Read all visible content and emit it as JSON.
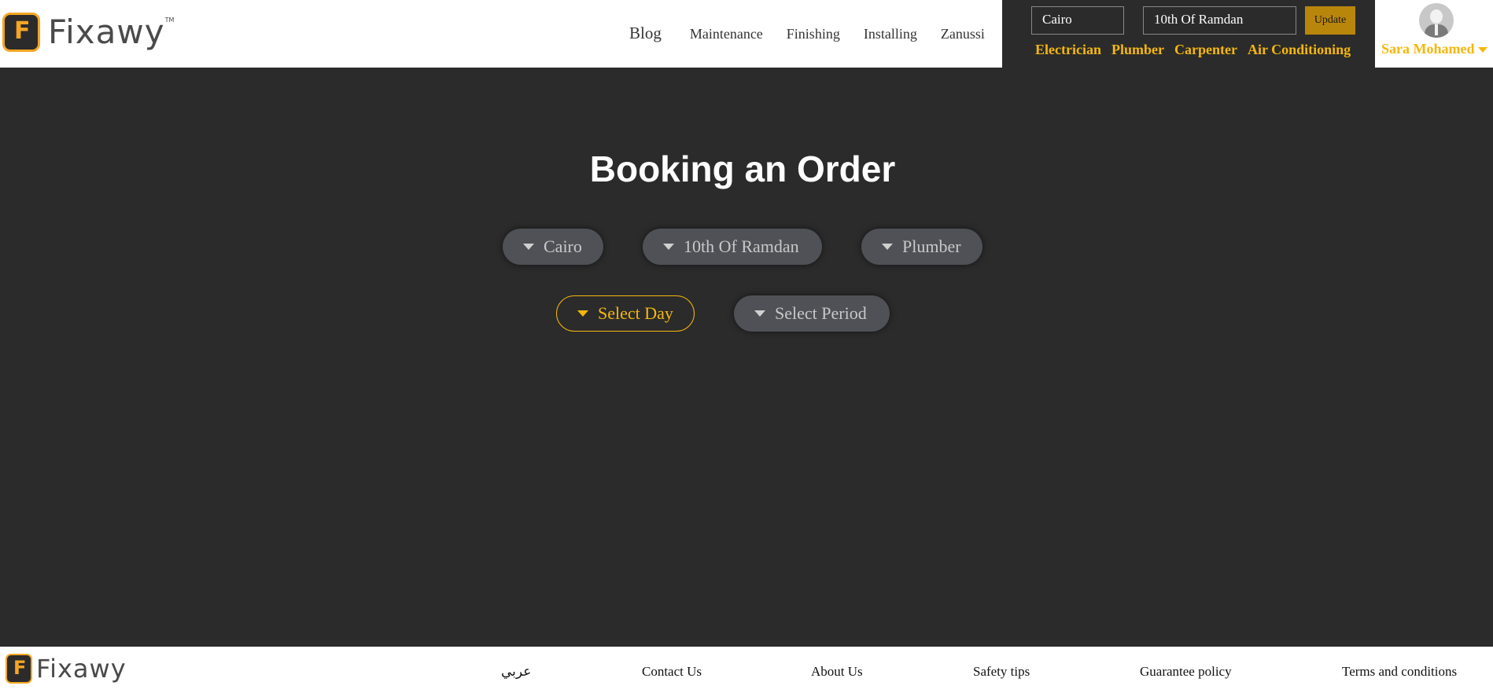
{
  "header": {
    "brand": "Fixawy",
    "brand_tm": "TM",
    "nav": [
      "Blog",
      "Maintenance",
      "Finishing",
      "Installing",
      "Zanussi"
    ],
    "city_select": "Cairo",
    "area_select": "10th Of Ramdan",
    "update_label": "Update",
    "categories": [
      "Electrician",
      "Plumber",
      "Carpenter",
      "Air Conditioning"
    ],
    "user_name": "Sara Mohamed"
  },
  "main": {
    "title": "Booking an Order",
    "city": "Cairo",
    "area": "10th Of Ramdan",
    "service": "Plumber",
    "day_placeholder": "Select Day",
    "period_placeholder": "Select Period"
  },
  "footer": {
    "brand": "Fixawy",
    "links": [
      "عربي",
      "Contact Us",
      "About Us",
      "Safety tips",
      "Guarantee policy",
      "Terms and conditions"
    ]
  },
  "colors": {
    "accent": "#f5b70d",
    "dark_bg": "#2b2b2b",
    "pill_bg": "#4f5157",
    "update_button": "#b8860b"
  }
}
